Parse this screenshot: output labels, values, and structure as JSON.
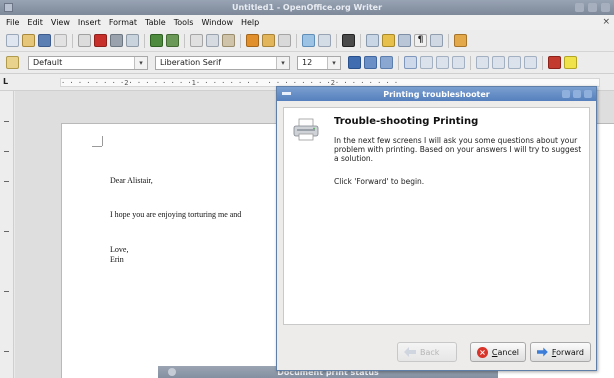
{
  "window": {
    "title": "Untitled1 - OpenOffice.org Writer"
  },
  "menubar": {
    "items": [
      {
        "id": "file",
        "label": "File"
      },
      {
        "id": "edit",
        "label": "Edit"
      },
      {
        "id": "view",
        "label": "View"
      },
      {
        "id": "insert",
        "label": "Insert"
      },
      {
        "id": "format",
        "label": "Format"
      },
      {
        "id": "table",
        "label": "Table"
      },
      {
        "id": "tools",
        "label": "Tools"
      },
      {
        "id": "window",
        "label": "Window"
      },
      {
        "id": "help",
        "label": "Help"
      }
    ],
    "close_glyph": "×"
  },
  "formatting": {
    "style": "Default",
    "font": "Liberation Serif",
    "size": "12"
  },
  "ruler": {
    "marks": "· · · · · · · ·2· · · · · · · ·1· · · · · · · ·  · · · · · · · ·2· · · · · · · ·"
  },
  "document": {
    "lines": [
      "Dear Alistair,",
      "I hope you are enjoying torturing me and",
      "Love,",
      "Erin"
    ]
  },
  "status_window": {
    "title": "Document print status"
  },
  "dialog": {
    "title": "Printing troubleshooter",
    "heading": "Trouble-shooting Printing",
    "paragraph": "In the next few screens I will ask you some questions about your problem with printing. Based on your answers I will try to suggest a solution.",
    "instruction": "Click 'Forward' to begin.",
    "back_label": "Back",
    "cancel_first": "C",
    "cancel_rest": "ancel",
    "forward_first": "F",
    "forward_rest": "orward"
  },
  "colors": {
    "dialog_title": "#5580bd",
    "cancel_icon": "#d8342a",
    "forward_icon": "#3b7dd8"
  }
}
